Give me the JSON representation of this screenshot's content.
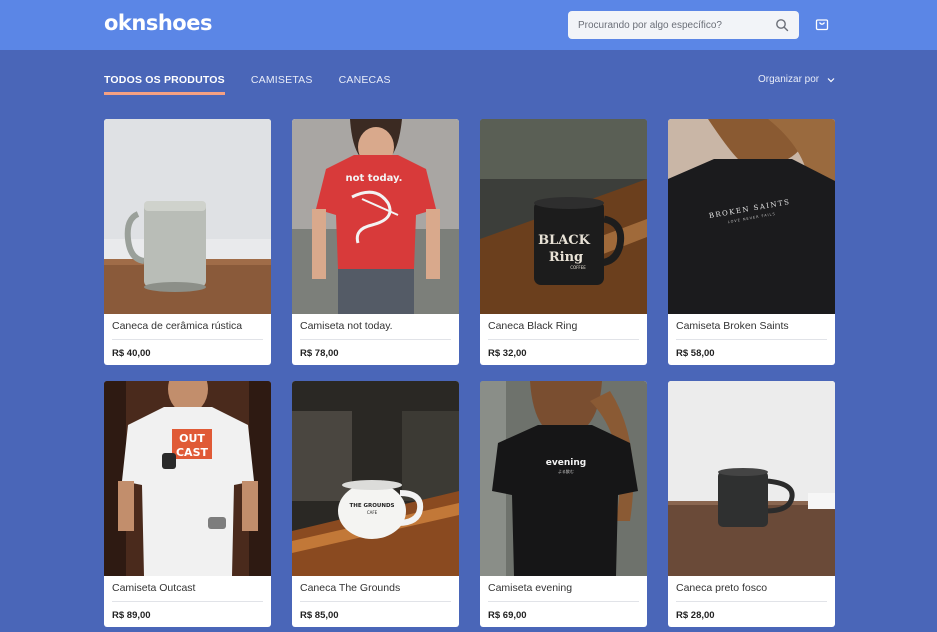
{
  "header": {
    "logo": "oknshoes",
    "search_placeholder": "Procurando por algo específico?"
  },
  "tabs": [
    {
      "label": "TODOS OS PRODUTOS",
      "active": true
    },
    {
      "label": "CAMISETAS",
      "active": false
    },
    {
      "label": "CANECAS",
      "active": false
    }
  ],
  "sort": {
    "label": "Organizar por"
  },
  "products": [
    {
      "name": "Caneca de cerâmica rústica",
      "price": "R$ 40,00"
    },
    {
      "name": "Camiseta not today.",
      "price": "R$ 78,00"
    },
    {
      "name": "Caneca Black Ring",
      "price": "R$ 32,00"
    },
    {
      "name": "Camiseta Broken Saints",
      "price": "R$ 58,00"
    },
    {
      "name": "Camiseta Outcast",
      "price": "R$ 89,00"
    },
    {
      "name": "Caneca The Grounds",
      "price": "R$ 85,00"
    },
    {
      "name": "Camiseta evening",
      "price": "R$ 69,00"
    },
    {
      "name": "Caneca preto fosco",
      "price": "R$ 28,00"
    }
  ],
  "image_text": {
    "not_today": "not today.",
    "black": "BLACK",
    "ring": "Ring",
    "coffee": "COFFEE",
    "broken_saints": "BROKEN SAINTS",
    "broken_saints_sub": "LOVE NEVER FAILS",
    "outcast_1": "OUT",
    "outcast_2": "CAST",
    "grounds": "THE GROUNDS",
    "cafe": "CAFE",
    "evening": "evening",
    "evening_sub": "よる飲む"
  },
  "colors": {
    "header_bg": "#5b86e6",
    "page_bg": "#4a66b8",
    "tab_underline": "#f5a082"
  }
}
